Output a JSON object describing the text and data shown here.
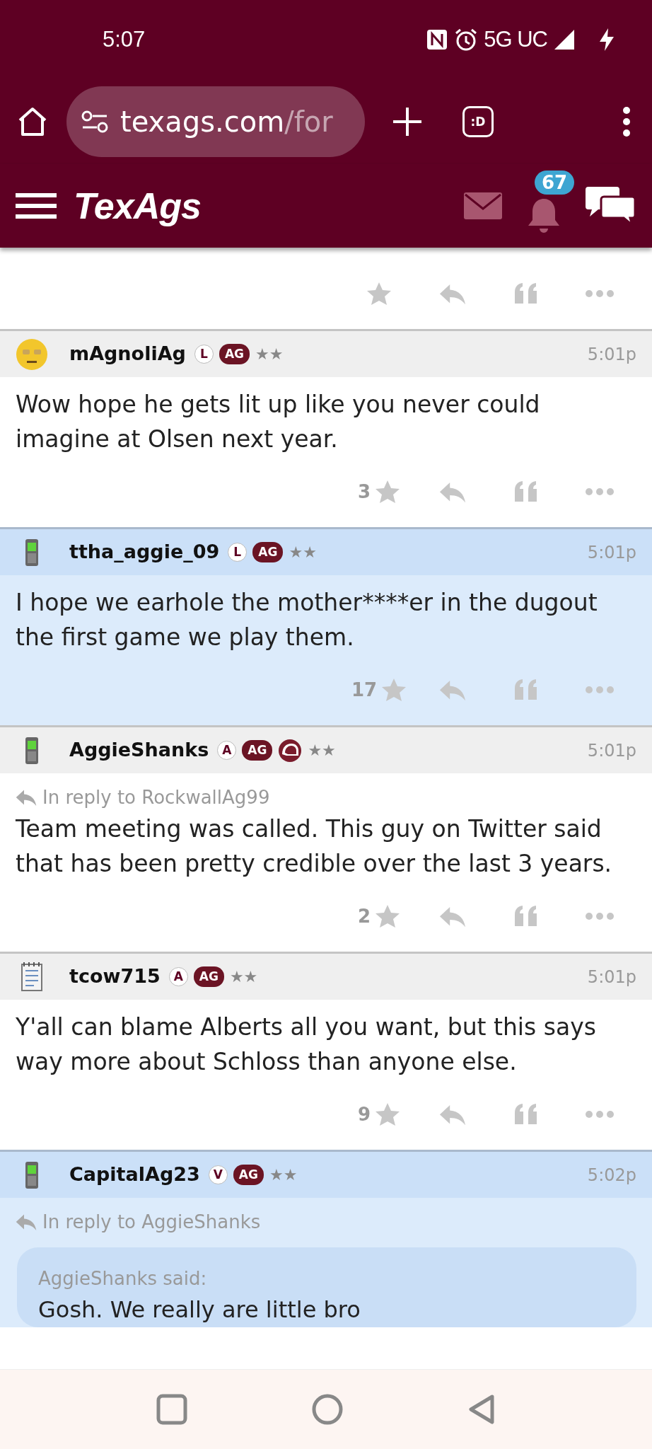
{
  "status_bar": {
    "time": "5:07",
    "network": "5G UC"
  },
  "browser": {
    "host": "texags.com",
    "path": "/for",
    "tab_label": ":D"
  },
  "site": {
    "logo": "TexAgs",
    "notification_count": "67"
  },
  "previous_post": {
    "actions": true
  },
  "posts": [
    {
      "avatar": {
        "kind": "emoji"
      },
      "username": "mAgnoliAg",
      "rank": "L",
      "team_badge": "AG",
      "helmet": false,
      "rank_stars": "★★",
      "time": "5:01p",
      "highlighted": false,
      "text": "Wow hope he gets lit up like you never could imagine at Olsen next year.",
      "likes": "3"
    },
    {
      "avatar": {
        "kind": "phone"
      },
      "username": "ttha_aggie_09",
      "rank": "L",
      "team_badge": "AG",
      "helmet": false,
      "rank_stars": "★★",
      "time": "5:01p",
      "highlighted": true,
      "text": "I hope we earhole the mother****er in the dugout the first game we play them.",
      "likes": "17"
    },
    {
      "avatar": {
        "kind": "phone"
      },
      "username": "AggieShanks",
      "rank": "A",
      "team_badge": "AG",
      "helmet": true,
      "rank_stars": "★★",
      "time": "5:01p",
      "highlighted": false,
      "reply_to": "In reply to RockwallAg99",
      "text": "Team meeting was called. This guy on Twitter said that has been pretty credible over the last 3 years.",
      "likes": "2"
    },
    {
      "avatar": {
        "kind": "notepad"
      },
      "username": "tcow715",
      "rank": "A",
      "team_badge": "AG",
      "helmet": false,
      "rank_stars": "★★",
      "time": "5:01p",
      "highlighted": false,
      "text": "Y'all can blame Alberts all you want, but this says way more about Schloss than anyone else.",
      "likes": "9"
    },
    {
      "avatar": {
        "kind": "phone"
      },
      "username": "CapitalAg23",
      "rank": "V",
      "team_badge": "AG",
      "helmet": false,
      "rank_stars": "★★",
      "time": "5:02p",
      "highlighted": true,
      "reply_to": "In reply to AggieShanks",
      "quote": {
        "author_line": "AggieShanks said:",
        "text": "Gosh. We really are little bro"
      }
    }
  ]
}
